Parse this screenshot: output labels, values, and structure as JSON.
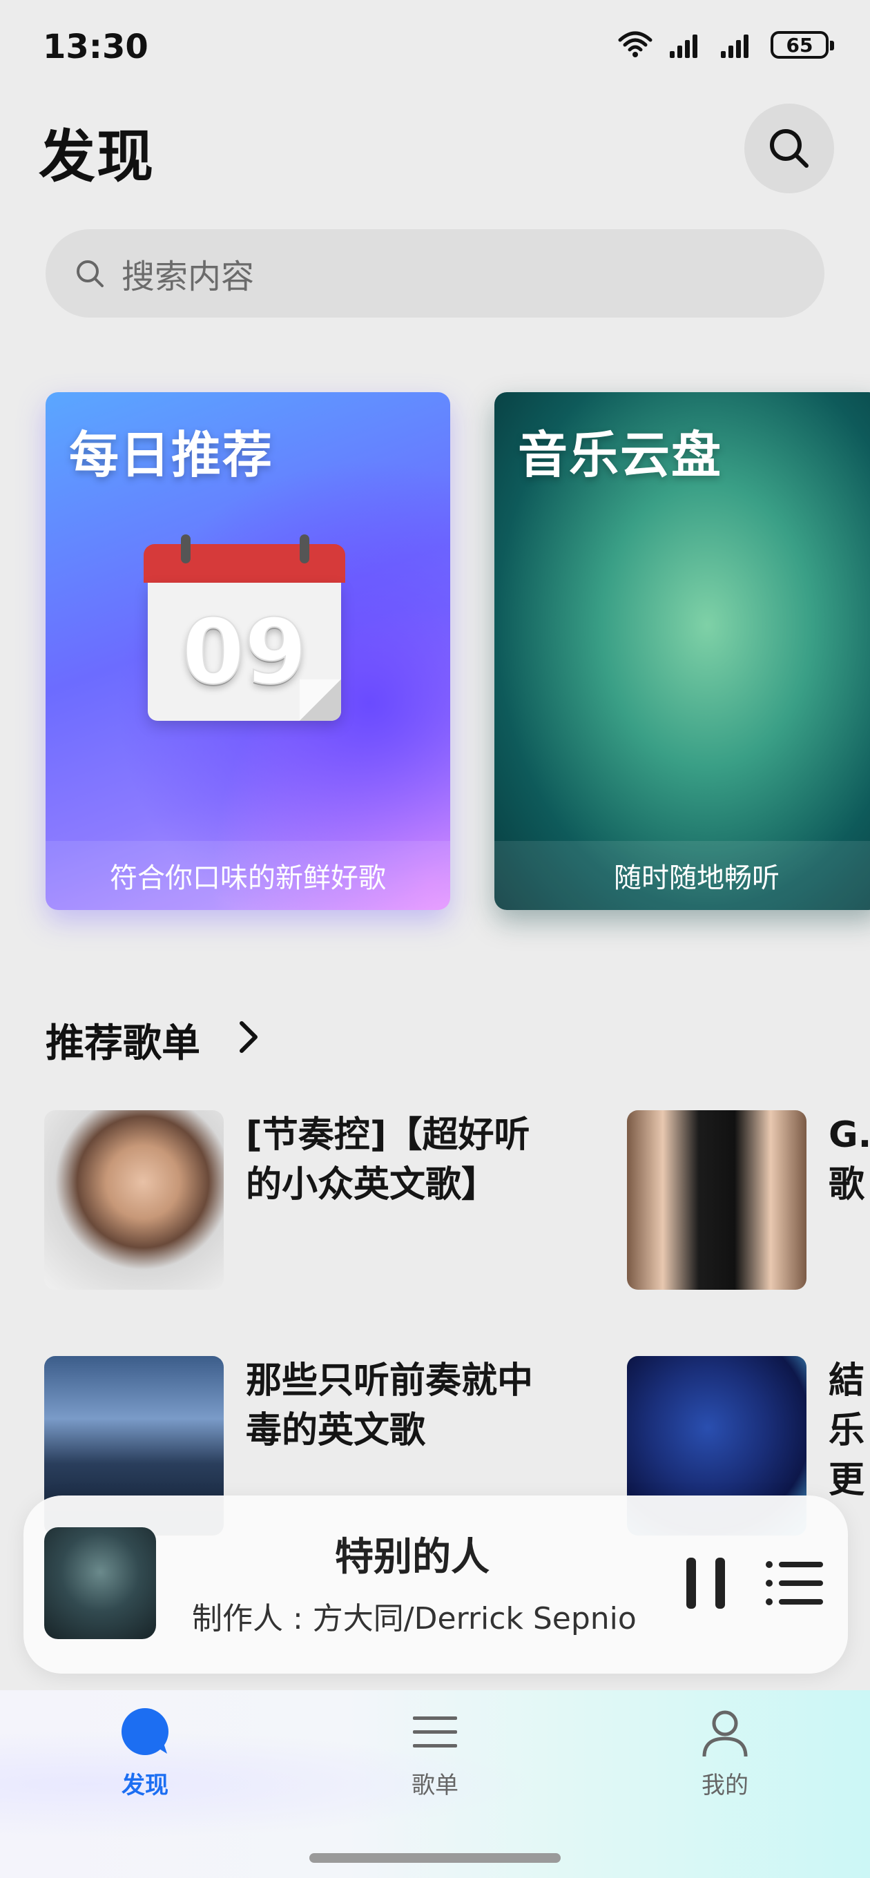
{
  "status_bar": {
    "time": "13:30",
    "battery": "65",
    "icons": [
      "wifi-icon",
      "signal-icon",
      "signal-icon",
      "battery-icon"
    ]
  },
  "header": {
    "title": "发现",
    "search_icon": "search-icon"
  },
  "search": {
    "placeholder": "搜索内容"
  },
  "cards": [
    {
      "title": "每日推荐",
      "subtitle": "符合你口味的新鲜好歌",
      "calendar_day": "09"
    },
    {
      "title": "音乐云盘",
      "subtitle": "随时随地畅听"
    }
  ],
  "recommended_playlists": {
    "section_title": "推荐歌单",
    "items": [
      {
        "title_line1": "[节奏控]【超好听",
        "title_line2": "的小众英文歌】"
      },
      {
        "title_line1": "G.",
        "title_line2": "歌"
      },
      {
        "title_line1": "那些只听前奏就中",
        "title_line2": "毒的英文歌"
      },
      {
        "title_line1": "結",
        "title_line2": "乐",
        "title_line3": "更"
      }
    ]
  },
  "player": {
    "song_title": "特别的人",
    "artist": "制作人 : 方大同/Derrick Sepnio"
  },
  "bottom_nav": {
    "items": [
      {
        "label": "发现",
        "icon": "discover-icon",
        "active": true
      },
      {
        "label": "歌单",
        "icon": "playlist-icon",
        "active": false
      },
      {
        "label": "我的",
        "icon": "profile-icon",
        "active": false
      }
    ]
  },
  "colors": {
    "accent": "#1c6ef2",
    "inactive": "#666666"
  }
}
